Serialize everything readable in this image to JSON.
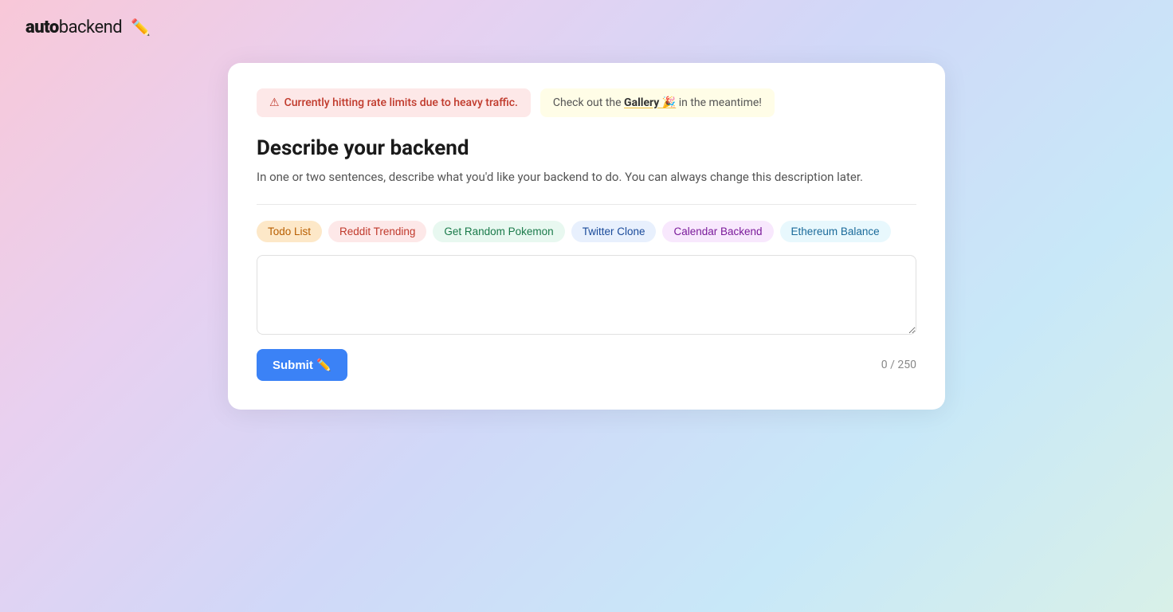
{
  "header": {
    "logo_auto": "auto",
    "logo_backend": "backend",
    "logo_icon": "✏️"
  },
  "alert": {
    "rate_limit_icon": "⚠",
    "rate_limit_text": "Currently hitting rate limits due to heavy traffic.",
    "gallery_prefix": "Check out the",
    "gallery_link_text": "Gallery 🎉",
    "gallery_suffix": "in the meantime!"
  },
  "form": {
    "title": "Describe your backend",
    "subtitle": "In one or two sentences, describe what you'd like your backend to do. You can always change this description later.",
    "textarea_placeholder": "",
    "suggestions": [
      {
        "id": "todo",
        "label": "Todo List",
        "style": "todo"
      },
      {
        "id": "reddit",
        "label": "Reddit Trending",
        "style": "reddit"
      },
      {
        "id": "pokemon",
        "label": "Get Random Pokemon",
        "style": "pokemon"
      },
      {
        "id": "twitter",
        "label": "Twitter Clone",
        "style": "twitter"
      },
      {
        "id": "calendar",
        "label": "Calendar Backend",
        "style": "calendar"
      },
      {
        "id": "ethereum",
        "label": "Ethereum Balance",
        "style": "ethereum"
      }
    ],
    "submit_label": "Submit ✏️",
    "char_count": "0 / 250"
  }
}
